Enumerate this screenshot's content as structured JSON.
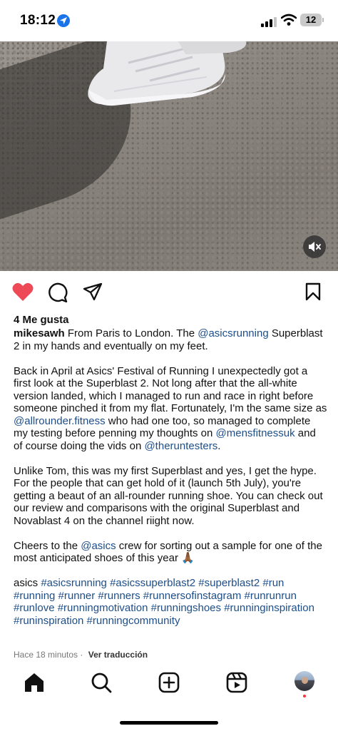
{
  "status_bar": {
    "time": "18:12",
    "battery": "12"
  },
  "post": {
    "likes": "4 Me gusta",
    "username": "mikesawh",
    "caption_paragraphs": [
      [
        {
          "t": "From Paris to London. The "
        },
        {
          "t": "@asicsrunning",
          "link": true
        },
        {
          "t": " Superblast 2 in my hands and eventually on my feet."
        }
      ],
      [
        {
          "t": "Back in April at Asics' Festival of Running I unexpectedly got a first look at the Superblast 2. Not long after that the all-white version landed, which I managed to run and race in right before someone pinched it from my flat. Fortunately, I'm the same size as "
        },
        {
          "t": "@allrounder.fitness",
          "link": true
        },
        {
          "t": " who had one too, so managed to complete my testing before penning my thoughts on "
        },
        {
          "t": "@mensfitnessuk",
          "link": true
        },
        {
          "t": " and of course doing the vids on "
        },
        {
          "t": "@theruntesters",
          "link": true
        },
        {
          "t": "."
        }
      ],
      [
        {
          "t": "Unlike Tom, this was my first Superblast and yes, I get the hype. For the people that can get hold of it (launch 5th July), you're getting a beaut of an all-rounder running shoe. You can check out our review and comparisons with the original Superblast and Novablast 4 on the channel riight now."
        }
      ],
      [
        {
          "t": "Cheers to the "
        },
        {
          "t": "@asics",
          "link": true
        },
        {
          "t": " crew for sorting out a sample for one of the most anticipated shoes of this year 🙏🏾"
        }
      ],
      [
        {
          "t": "asics "
        },
        {
          "t": "#asicsrunning #asicssuperblast2 #superblast2 #run #running #runner #runners #runnersofinstagram #runrunrun #runlove #runningmotivation #runningshoes #runninginspiration #runinspiration #runningcommunity",
          "link": true
        }
      ]
    ],
    "time_ago": "Hace 18 minutos",
    "separator": "·",
    "translate_label": "Ver traducción"
  },
  "colors": {
    "like": "#ed4956",
    "link": "#1d4e89",
    "meta": "#777777"
  },
  "icons": {
    "actions": [
      "heart-filled-icon",
      "comment-icon",
      "share-icon",
      "bookmark-icon"
    ],
    "nav": [
      "home-icon",
      "search-icon",
      "create-icon",
      "reels-icon",
      "profile-avatar"
    ]
  }
}
